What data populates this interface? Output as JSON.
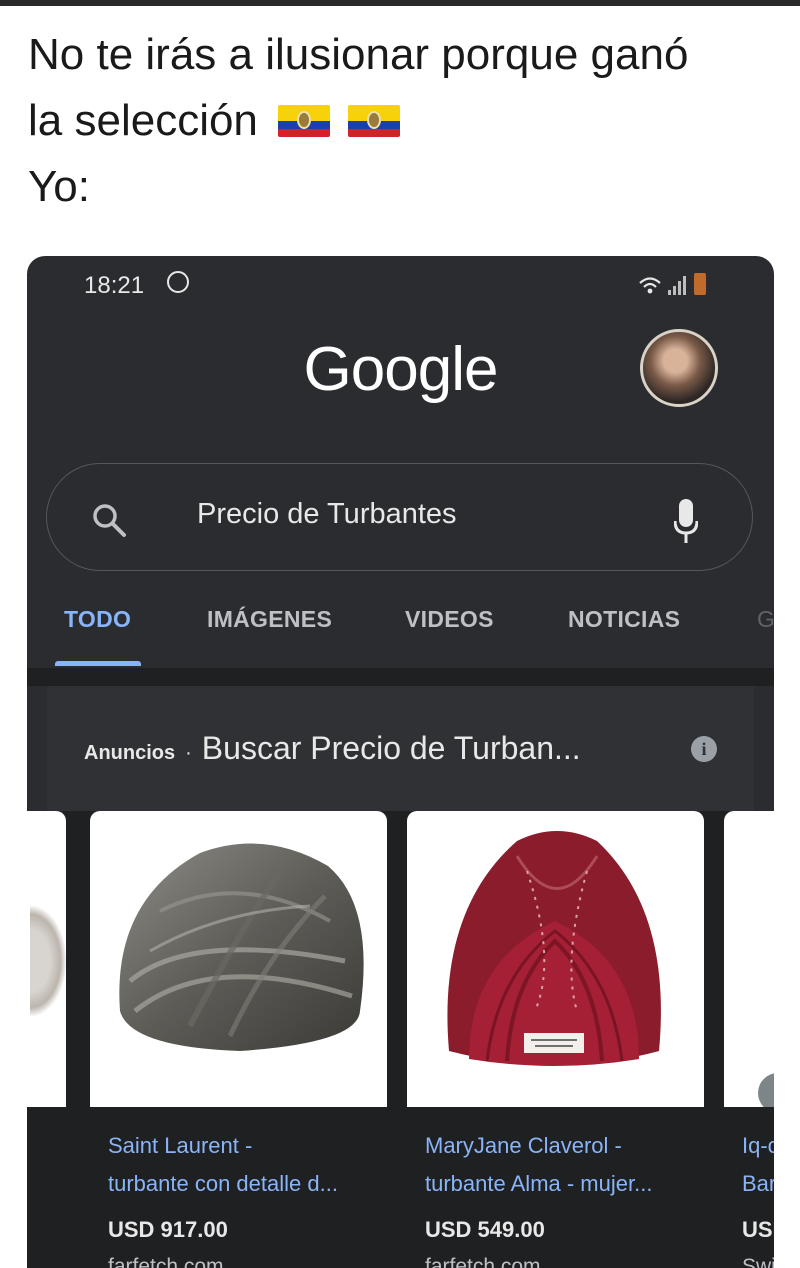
{
  "caption": {
    "line1": "No te irás a ilusionar porque ganó",
    "line2": "la selección",
    "line3": "Yo:",
    "flag_colors": [
      "#f7d20a",
      "#1b3fae",
      "#d3202d"
    ]
  },
  "status_bar": {
    "time": "18:21",
    "icons": [
      "whatsapp-icon",
      "wifi-icon",
      "signal-icon",
      "battery-icon"
    ]
  },
  "header": {
    "logo": "Google",
    "avatar": "profile-avatar"
  },
  "search": {
    "query": "Precio de Turbantes",
    "icons": [
      "search-icon",
      "mic-icon"
    ]
  },
  "tabs": [
    {
      "label": "TODO",
      "active": true
    },
    {
      "label": "IMÁGENES"
    },
    {
      "label": "VIDEOS"
    },
    {
      "label": "NOTICIAS"
    },
    {
      "label": "G"
    }
  ],
  "ads": {
    "label": "Anuncios",
    "separator": "·",
    "title": "Buscar Precio de Turban...",
    "info_glyph": "i"
  },
  "products": [
    {
      "title_line1": "",
      "title_line2": "",
      "price": "",
      "merchant": ""
    },
    {
      "title_line1": "Saint Laurent -",
      "title_line2": "turbante con detalle d...",
      "price": "USD 917.00",
      "merchant": "farfetch.com"
    },
    {
      "title_line1": "MaryJane Claverol -",
      "title_line2": "turbante Alma - mujer...",
      "price": "USD 549.00",
      "merchant": "farfetch.com"
    },
    {
      "title_line1": "Iq-c",
      "title_line2": "Bar",
      "price": "USI",
      "merchant": "Swi"
    }
  ],
  "colors": {
    "accent": "#8ab4f8",
    "dark_bg": "#2b2c30",
    "card_bg": "#303134"
  }
}
